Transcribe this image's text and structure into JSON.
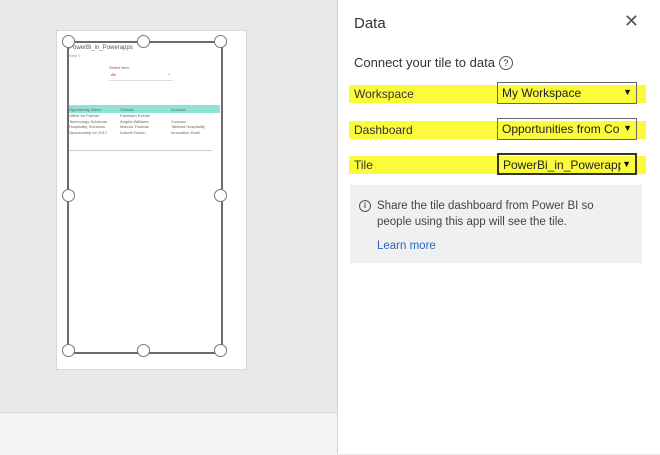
{
  "preview": {
    "app_title": "PowerBi_in_Powerapps",
    "app_subtitle": "Step 1",
    "filter_label": "Select item",
    "filter_value": "All",
    "table_headers": [
      "Opportunity Name",
      "Contact",
      "Account"
    ],
    "table_rows": [
      [
        "Office for Partner",
        "Fabrikam Events",
        ""
      ],
      [
        "Technology Solutions",
        "Angela Williams",
        "Contoso"
      ],
      [
        "Hospitality Solutions",
        "Marcus Thomas",
        "Tailwind Hospitality"
      ],
      [
        "Sponsorship for 2017",
        "Lisbeth Rosen",
        "Innovation Hotel"
      ]
    ]
  },
  "panel": {
    "title": "Data",
    "close_glyph": "✕",
    "connect_text": "Connect your tile to data",
    "help_glyph": "?",
    "fields": [
      {
        "label": "Workspace",
        "value": "My Workspace"
      },
      {
        "label": "Dashboard",
        "value": "Opportunities from Co"
      },
      {
        "label": "Tile",
        "value": "PowerBi_in_Powerapps"
      }
    ],
    "dropdown_arrow": "▼",
    "info_glyph": "i",
    "info_text": "Share the tile dashboard from Power BI so people using this app will see the tile.",
    "learn_more": "Learn more"
  },
  "colors": {
    "highlight": "#fbfb3c",
    "table_header": "#8ee2d6",
    "link": "#2a66c0"
  },
  "icons": {
    "close": "close-icon",
    "help": "help-icon",
    "info": "info-icon",
    "dropdown": "chevron-down-icon"
  }
}
